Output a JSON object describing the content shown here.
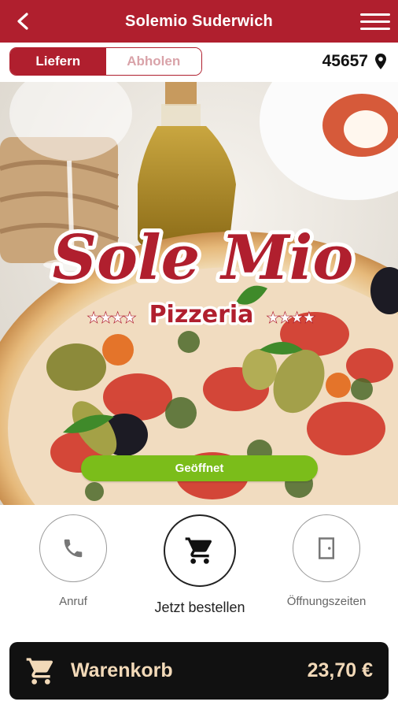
{
  "header": {
    "title": "Solemio Suderwich",
    "back_icon": "chevron-left-icon",
    "menu_icon": "hamburger-menu-icon"
  },
  "delivery_toggle": {
    "options": [
      {
        "label": "Liefern",
        "active": true
      },
      {
        "label": "Abholen",
        "active": false
      }
    ]
  },
  "location": {
    "zip": "45657",
    "icon": "location-pin-icon"
  },
  "hero": {
    "logo_main": "Sole Mio",
    "logo_sub": "Pizzeria",
    "stars": "★★★★",
    "status_label": "Geöffnet"
  },
  "actions": [
    {
      "label": "Anruf",
      "icon": "phone-icon"
    },
    {
      "label": "Jetzt bestellen",
      "icon": "cart-icon"
    },
    {
      "label": "Öffnungszeiten",
      "icon": "door-icon"
    }
  ],
  "cart": {
    "label": "Warenkorb",
    "total": "23,70 €",
    "icon": "cart-icon"
  },
  "colors": {
    "brand_red": "#b01f2e",
    "open_green": "#7bbd1a",
    "cart_bg": "#111111",
    "cart_text": "#f2d9b8"
  }
}
